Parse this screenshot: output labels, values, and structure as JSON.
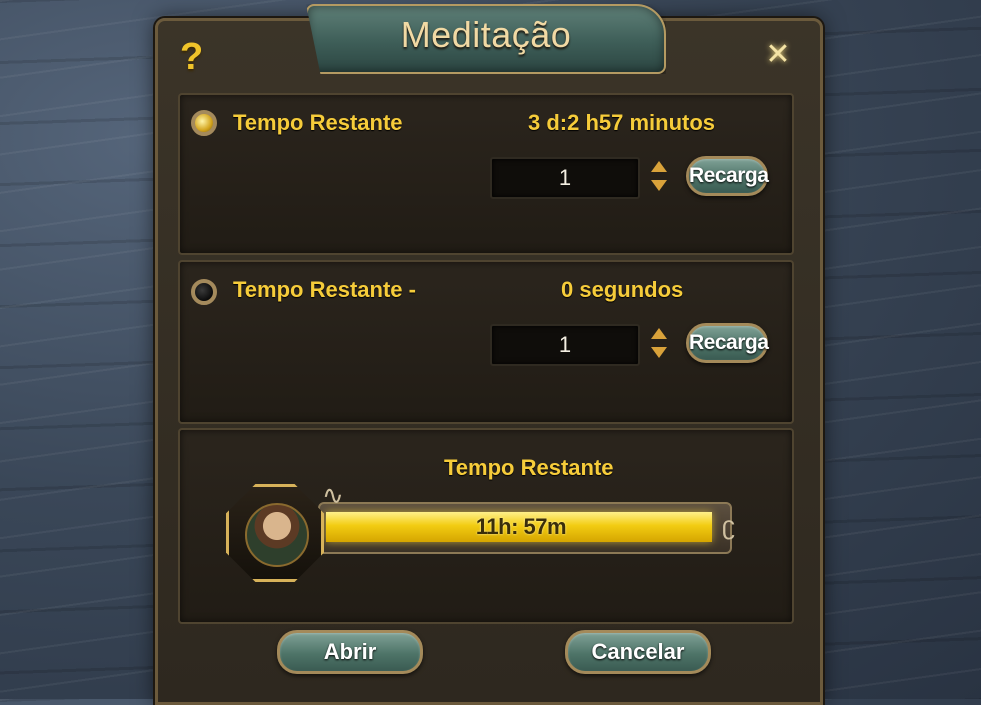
{
  "dialog": {
    "title": "Meditação",
    "help_label": "?",
    "close_label": "✕"
  },
  "rows": [
    {
      "label": "Tempo Restante",
      "value": "3 d:2 h57 minutos",
      "quantity": "1",
      "button": "Recarga",
      "orb": "gold"
    },
    {
      "label": "Tempo Restante -",
      "value": "0 segundos",
      "quantity": "1",
      "button": "Recarga",
      "orb": "dark"
    }
  ],
  "progress": {
    "label": "Tempo Restante",
    "time_text": "11h: 57m",
    "fill_fraction": 0.99,
    "bar_color": "#f2cc12"
  },
  "buttons": {
    "open_label": "Abrir",
    "cancel_label": "Cancelar"
  },
  "icons": {
    "help": "question-mark-icon",
    "close": "close-x-icon",
    "portrait": "character-portrait",
    "spinner": "up-down-spinner-icon"
  }
}
